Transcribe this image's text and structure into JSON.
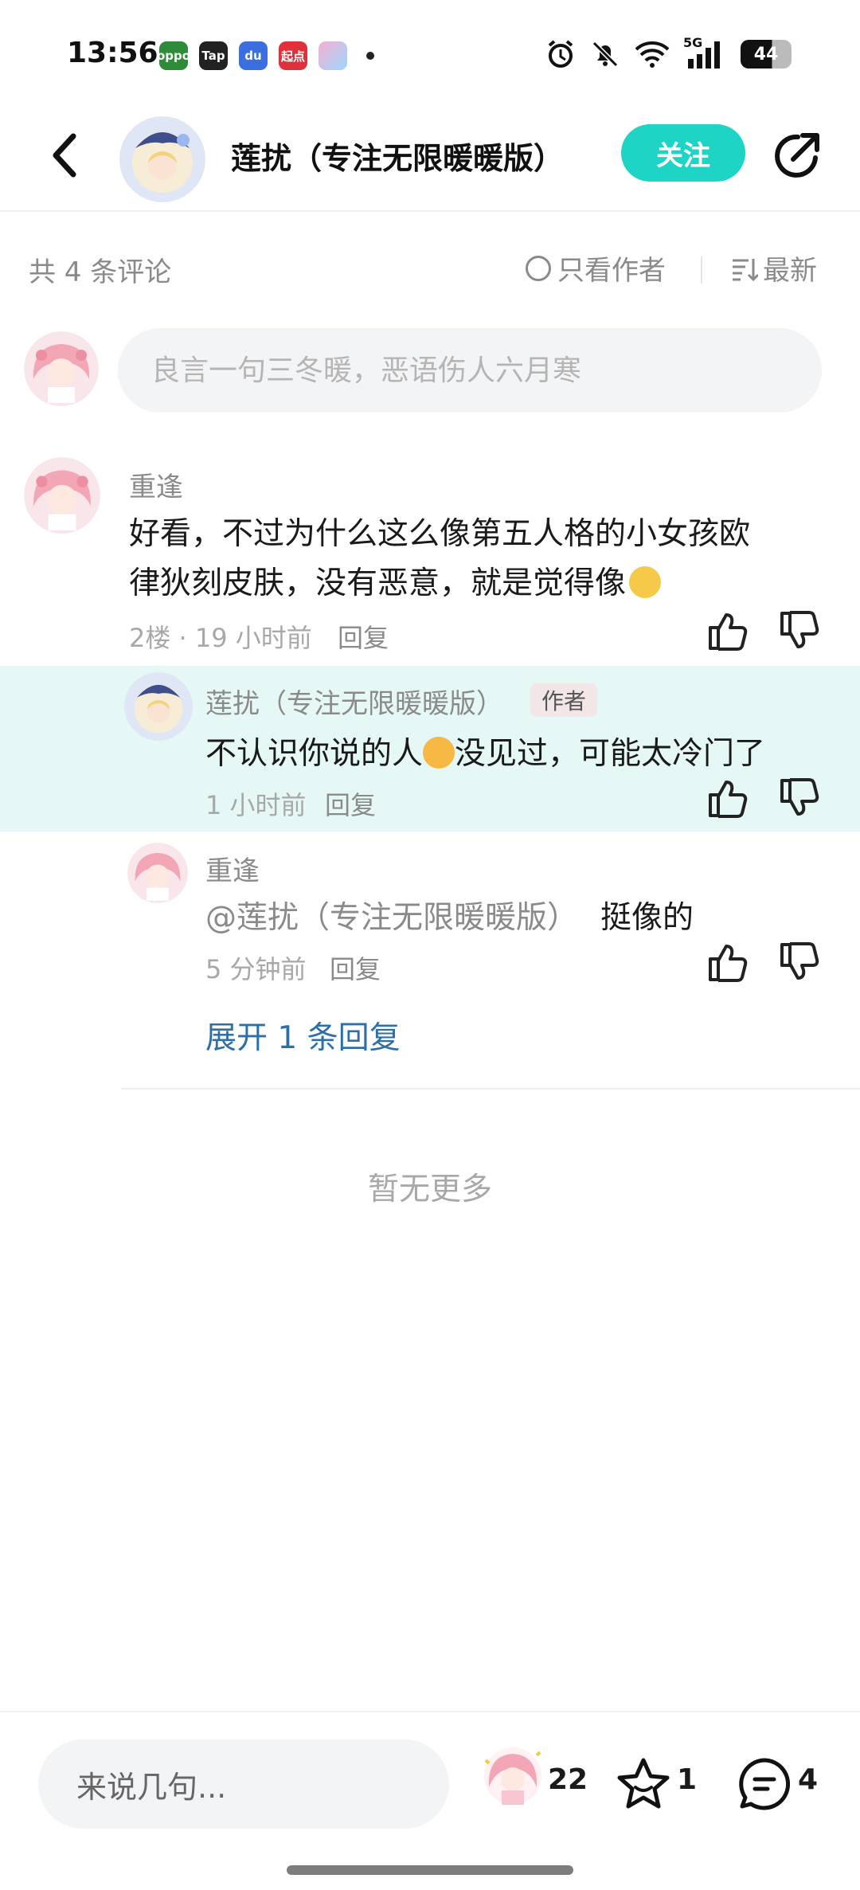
{
  "status_bar": {
    "time": "13:56",
    "battery": "44",
    "network": "5G",
    "apps": [
      {
        "name": "oppo-app-icon",
        "label": "oppo",
        "color": "#2e8b3a"
      },
      {
        "name": "taptap-icon",
        "label": "Tap",
        "color": "#222222"
      },
      {
        "name": "baidu-icon",
        "label": "du",
        "color": "#3b6fe0"
      },
      {
        "name": "qidian-icon",
        "label": "起点",
        "color": "#e0303c"
      },
      {
        "name": "colorful-app-icon",
        "label": "",
        "color": "#f5a0c8"
      }
    ]
  },
  "header": {
    "title": "莲扰（专注无限暖暖版）",
    "follow_label": "关注"
  },
  "toolbar": {
    "comment_count": "共 4 条评论",
    "author_only": "只看作者",
    "sort": "最新"
  },
  "input": {
    "placeholder": "良言一句三冬暖，恶语伤人六月寒"
  },
  "comments": [
    {
      "author": "重逢",
      "text_line1": "好看，不过为什么这么像第五人格的小女孩欧",
      "text_line2": "律狄刻皮肤，没有恶意，就是觉得像",
      "floor": "2楼 · 19 小时前",
      "reply_label": "回复"
    }
  ],
  "replies": [
    {
      "author": "莲扰（专注无限暖暖版）",
      "badge": "作者",
      "text_part1": "不认识你说的人",
      "text_part2": "没见过，可能太冷门了",
      "time": "1 小时前",
      "reply_label": "回复"
    },
    {
      "author": "重逢",
      "mention": "@莲扰（专注无限暖暖版）",
      "text": "挺像的",
      "time": "5 分钟前",
      "reply_label": "回复"
    }
  ],
  "expand_label": "展开 1 条回复",
  "no_more": "暂无更多",
  "bottom_bar": {
    "placeholder": "来说几句...",
    "like_count": "22",
    "favorite_count": "1",
    "comment_count": "4"
  },
  "colors": {
    "accent": "#1ed4c4",
    "reply_highlight": "#e6f8f6",
    "link": "#2e6fa8"
  }
}
